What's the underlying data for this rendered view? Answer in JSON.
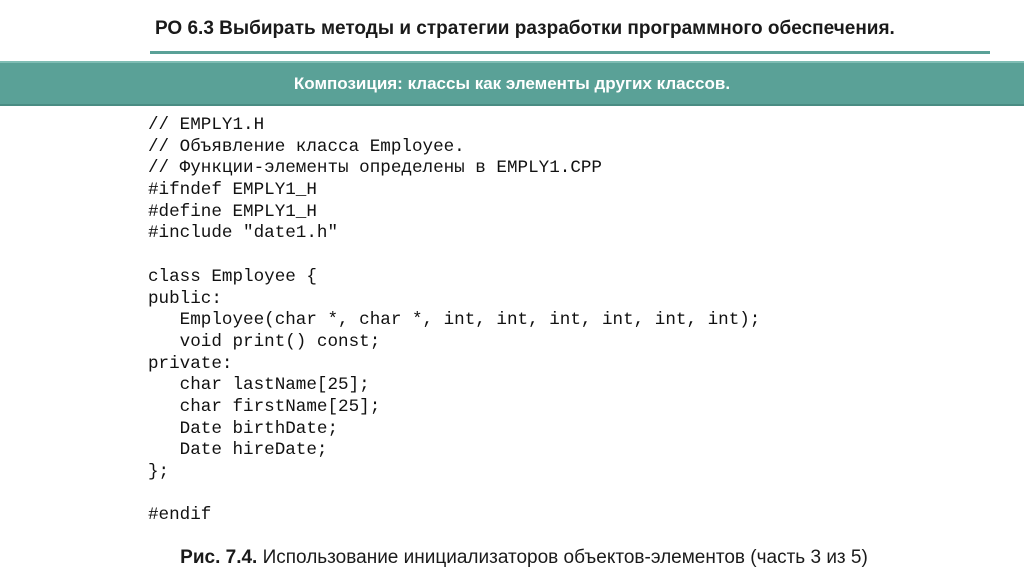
{
  "header": {
    "title": "РО 6.3 Выбирать методы и стратегии разработки программного обеспечения."
  },
  "banner": {
    "text": "Композиция: классы как элементы других классов."
  },
  "code": {
    "lines": [
      "// EMPLY1.H",
      "// Объявление класса Employee.",
      "// Функции-элементы определены в EMPLY1.CPP",
      "#ifndef EMPLY1_H",
      "#define EMPLY1_H",
      "#include \"date1.h\"",
      "",
      "class Employee {",
      "public:",
      "   Employee(char *, char *, int, int, int, int, int, int);",
      "   void print() const;",
      "private:",
      "   char lastName[25];",
      "   char firstName[25];",
      "   Date birthDate;",
      "   Date hireDate;",
      "};",
      "",
      "#endif"
    ]
  },
  "caption": {
    "label": "Рис. 7.4.",
    "text": " Использование инициализаторов объектов-элементов (часть 3 из 5)"
  },
  "colors": {
    "accent": "#5aa197",
    "banner_text": "#ffffff"
  }
}
